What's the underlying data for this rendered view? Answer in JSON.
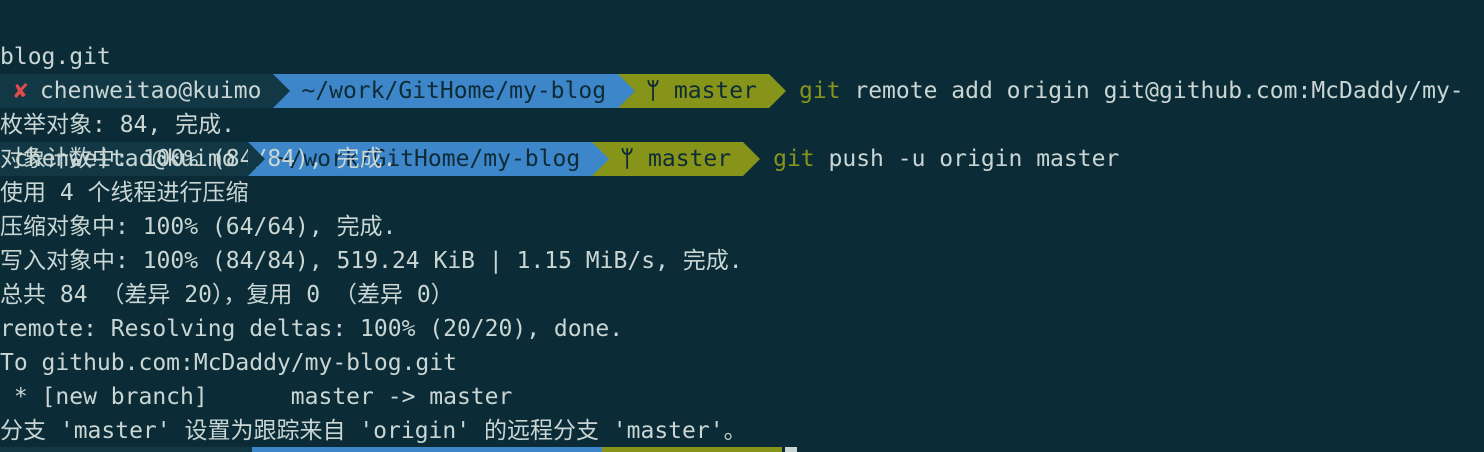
{
  "prompt1": {
    "status_icon": "x-mark",
    "status_glyph": "✘",
    "user": "chenweitao@kuimo",
    "dir": "~/work/GitHome/my-blog",
    "branch_glyph": "ᛘ",
    "branch": "master",
    "cmd_git": "git",
    "cmd_rest": " remote add origin git@github.com:McDaddy/my-",
    "wrap": "blog.git"
  },
  "prompt2": {
    "user": "chenweitao@kuimo",
    "dir": "~/work/GitHome/my-blog",
    "branch_glyph": "ᛘ",
    "branch": "master",
    "cmd_git": "git",
    "cmd_rest": " push -u origin master"
  },
  "output": [
    "枚举对象: 84, 完成.",
    "对象计数中: 100% (84/84), 完成.",
    "使用 4 个线程进行压缩",
    "压缩对象中: 100% (64/64), 完成.",
    "写入对象中: 100% (84/84), 519.24 KiB | 1.15 MiB/s, 完成.",
    "总共 84 （差异 20），复用 0 （差异 0）",
    "remote: Resolving deltas: 100% (20/20), done.",
    "To github.com:McDaddy/my-blog.git",
    " * [new branch]      master -> master",
    "分支 'master' 设置为跟踪来自 'origin' 的远程分支 'master'。"
  ],
  "colors": {
    "background": "#0b2b37",
    "user_segment": "#123846",
    "dir_segment": "#3d86c9",
    "git_segment": "#86951a",
    "error": "#e04c4c",
    "text": "#c9d6d4"
  }
}
